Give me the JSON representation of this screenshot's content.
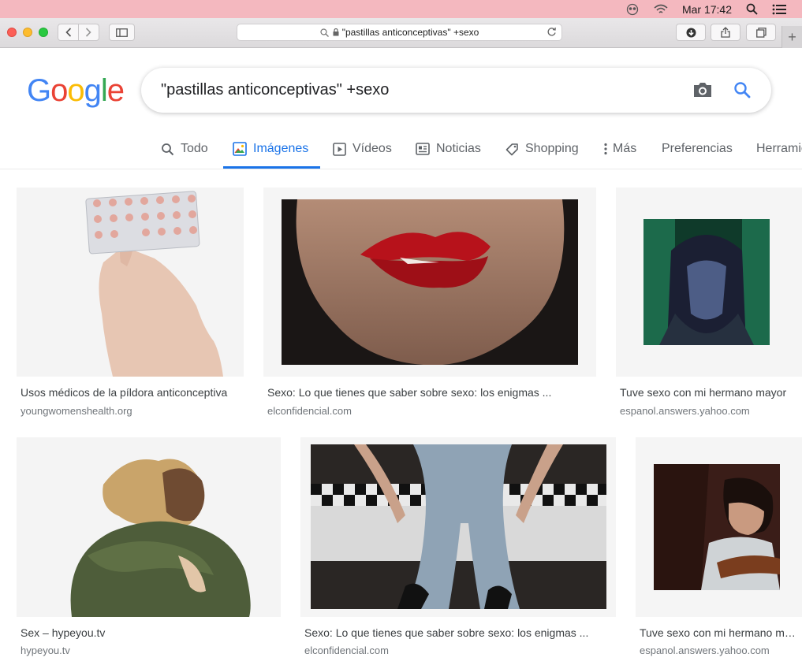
{
  "menubar": {
    "clock": "Mar 17:42"
  },
  "browser": {
    "address": "\"pastillas anticonceptivas\" +sexo",
    "new_tab": "+"
  },
  "google": {
    "logo_letters": [
      "G",
      "o",
      "o",
      "g",
      "l",
      "e"
    ],
    "logo_colors": [
      "#4285f4",
      "#ea4335",
      "#fbbc05",
      "#4285f4",
      "#34a853",
      "#ea4335"
    ],
    "query": "\"pastillas anticonceptivas\" +sexo"
  },
  "tabs": [
    {
      "label": "Todo",
      "icon": "search-icon",
      "active": false
    },
    {
      "label": "Imágenes",
      "icon": "image-icon",
      "active": true
    },
    {
      "label": "Vídeos",
      "icon": "video-icon",
      "active": false
    },
    {
      "label": "Noticias",
      "icon": "news-icon",
      "active": false
    },
    {
      "label": "Shopping",
      "icon": "tag-icon",
      "active": false
    },
    {
      "label": "Más",
      "icon": "more-vert-icon",
      "active": false
    },
    {
      "label": "Preferencias",
      "active": false
    },
    {
      "label": "Herramientas",
      "active": false
    }
  ],
  "results": [
    {
      "title": "Usos médicos de la píldora anticonceptiva",
      "domain": "youngwomenshealth.org"
    },
    {
      "title": "Sexo: Lo que tienes que saber sobre sexo: los enigmas ...",
      "domain": "elconfidencial.com"
    },
    {
      "title": "Tuve sexo con mi hermano mayor",
      "domain": "espanol.answers.yahoo.com"
    },
    {
      "title": "Sex – hypeyou.tv",
      "domain": "hypeyou.tv"
    },
    {
      "title": "Sexo: Lo que tienes que saber sobre sexo: los enigmas ...",
      "domain": "elconfidencial.com"
    },
    {
      "title": "Tuve sexo con mi hermano mayor",
      "domain": "espanol.answers.yahoo.com"
    }
  ],
  "colors": {
    "accent": "#1a73e8",
    "menubar": "#f4b8bf"
  }
}
